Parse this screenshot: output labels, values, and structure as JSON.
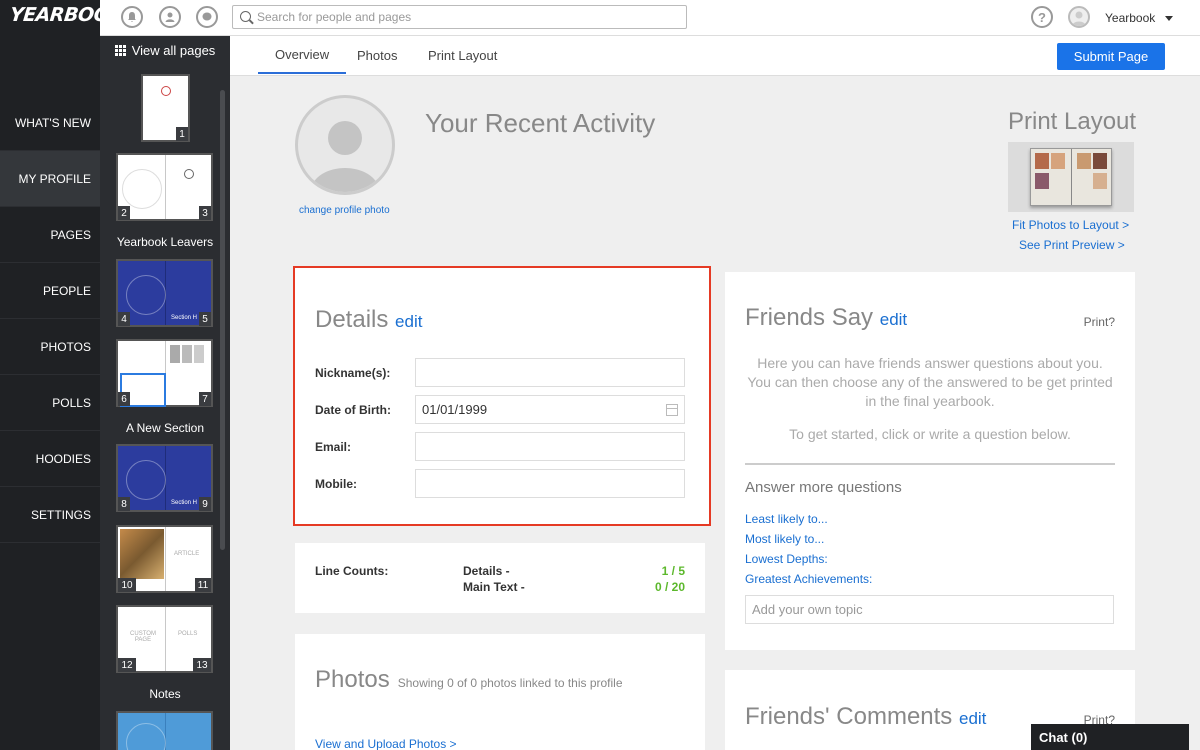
{
  "app": {
    "logo": "YEARBOOK"
  },
  "nav": {
    "items": [
      {
        "label": "WHAT'S NEW"
      },
      {
        "label": "MY PROFILE"
      },
      {
        "label": "PAGES"
      },
      {
        "label": "PEOPLE"
      },
      {
        "label": "PHOTOS"
      },
      {
        "label": "POLLS"
      },
      {
        "label": "HOODIES"
      },
      {
        "label": "SETTINGS"
      }
    ]
  },
  "pagestrip": {
    "view_all": "View all pages",
    "sections": [
      "Yearbook Leavers",
      "A New Section",
      "Notes"
    ],
    "page_numbers": [
      "1",
      "2",
      "3",
      "4",
      "5",
      "6",
      "7",
      "8",
      "9",
      "10",
      "11",
      "12",
      "13"
    ],
    "thumb_texts": {
      "article": "ARTICLE",
      "polls": "POLLS",
      "custom": "CUSTOM PAGE",
      "section": "Section H"
    }
  },
  "topbar": {
    "search_placeholder": "Search for people and pages",
    "help": "?",
    "user_name": "Yearbook"
  },
  "tabs": [
    {
      "label": "Overview"
    },
    {
      "label": "Photos"
    },
    {
      "label": "Print Layout"
    }
  ],
  "submit_label": "Submit Page",
  "profile": {
    "change_photo": "change profile photo",
    "recent_title": "Your Recent Activity"
  },
  "print_layout": {
    "title": "Print Layout",
    "fit_link": "Fit Photos to Layout >",
    "preview_link": "See Print Preview >"
  },
  "details": {
    "title": "Details",
    "edit": "edit",
    "fields": [
      {
        "label": "Nickname(s):",
        "value": ""
      },
      {
        "label": "Date of Birth:",
        "value": "01/01/1999"
      },
      {
        "label": "Email:",
        "value": ""
      },
      {
        "label": "Mobile:",
        "value": ""
      }
    ]
  },
  "line_counts": {
    "label": "Line Counts:",
    "rows": [
      {
        "name": "Details -",
        "value": "1 / 5"
      },
      {
        "name": "Main Text -",
        "value": "0 / 20"
      }
    ],
    "value_color": "#5cb82c"
  },
  "photos": {
    "title": "Photos",
    "subtitle": "Showing 0 of 0 photos linked to this profile",
    "link": "View and Upload Photos >"
  },
  "friends": {
    "title": "Friends Say",
    "edit": "edit",
    "print": "Print?",
    "desc": "Here you can have friends answer questions about you. You can then choose any of the answered to be get printed in the final yearbook.",
    "start": "To get started, click or write a question below.",
    "more_title": "Answer more questions",
    "questions": [
      "Least likely to...",
      "Most likely to...",
      "Lowest Depths:",
      "Greatest Achievements:"
    ],
    "topic_placeholder": "Add your own topic"
  },
  "comments": {
    "title": "Friends' Comments",
    "edit": "edit",
    "print": "Print?"
  },
  "chat": {
    "label": "Chat (0)"
  },
  "colors": {
    "accent": "#1a73e8",
    "highlight": "#e53a24",
    "nav_bg": "#1f2124"
  }
}
